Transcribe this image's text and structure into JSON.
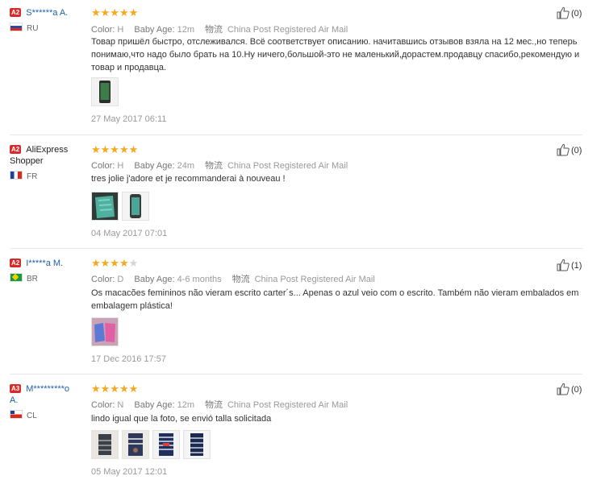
{
  "labels": {
    "color": "Color:",
    "baby_age": "Baby Age:",
    "ship_cn": "物流"
  },
  "reviews": [
    {
      "badge": "A2",
      "name_a": "S******a A.",
      "name_b": "",
      "country": "RU",
      "rating": 5,
      "color": "H",
      "baby_age": "12m",
      "shipping": "China Post Registered Air Mail",
      "text": "Товар пришёл быстро, отслеживался. Всё соответствует описанию. начитавшись отзывов взяла на 12 мес.,но теперь понимаю,что надо было брать на 10.Ну ничего,большой-это не маленький,дорастем.продавцу спасибо,рекомендую и товар и продавца.",
      "date": "27 May 2017 06:11",
      "likes": "(0)"
    },
    {
      "badge": "A2",
      "name_a": "AliExpress",
      "name_b": "Shopper",
      "country": "FR",
      "rating": 5,
      "color": "H",
      "baby_age": "24m",
      "shipping": "China Post Registered Air Mail",
      "text": "tres jolie j'adore et je recommanderai à nouveau !",
      "date": "04 May 2017 07:01",
      "likes": "(0)"
    },
    {
      "badge": "A2",
      "name_a": "I*****a M.",
      "name_b": "",
      "country": "BR",
      "rating": 4,
      "color": "D",
      "baby_age": "4-6 months",
      "shipping": "China Post Registered Air Mail",
      "text": "Os macacões femininos não vieram escrito carter´s... Apenas o azul veio com o escrito. Também não vieram embalados em embalagem plástica!",
      "date": "17 Dec 2016 17:57",
      "likes": "(1)"
    },
    {
      "badge": "A3",
      "name_a": "M*********o",
      "name_b": "A.",
      "country": "CL",
      "rating": 5,
      "color": "N",
      "baby_age": "12m",
      "shipping": "China Post Registered Air Mail",
      "text": "lindo igual que la foto, se envió talla solicitada",
      "date": "05 May 2017 12:01",
      "likes": "(0)"
    }
  ]
}
